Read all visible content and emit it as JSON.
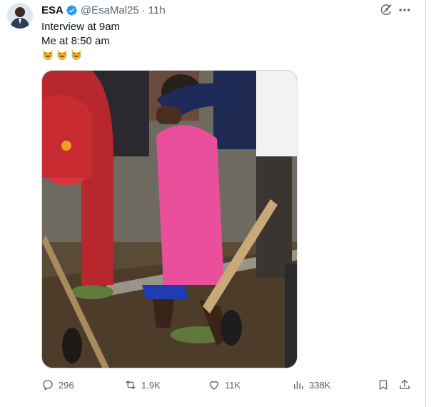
{
  "tweet": {
    "author_name": "ESA",
    "handle": "@EsaMal25",
    "separator": "·",
    "time": "11h",
    "text_lines": [
      "Interview at 9am",
      "Me at 8:50 am"
    ],
    "emojis": [
      "laughing-crying-cat-icon",
      "laughing-crying-cat-icon",
      "laughing-crying-cat-icon"
    ],
    "media_description": ""
  },
  "actions": {
    "replies": "296",
    "retweets": "1.9K",
    "likes": "11K",
    "views": "338K"
  },
  "colors": {
    "verified_badge": "#1d9bf0",
    "secondary_text": "#536471",
    "primary_text": "#0f1419",
    "border": "#cfd9de"
  },
  "icons": {
    "header": [
      "grok-icon",
      "more-icon"
    ],
    "actions": [
      "reply-icon",
      "retweet-icon",
      "like-icon",
      "views-icon",
      "bookmark-icon",
      "share-icon"
    ]
  }
}
